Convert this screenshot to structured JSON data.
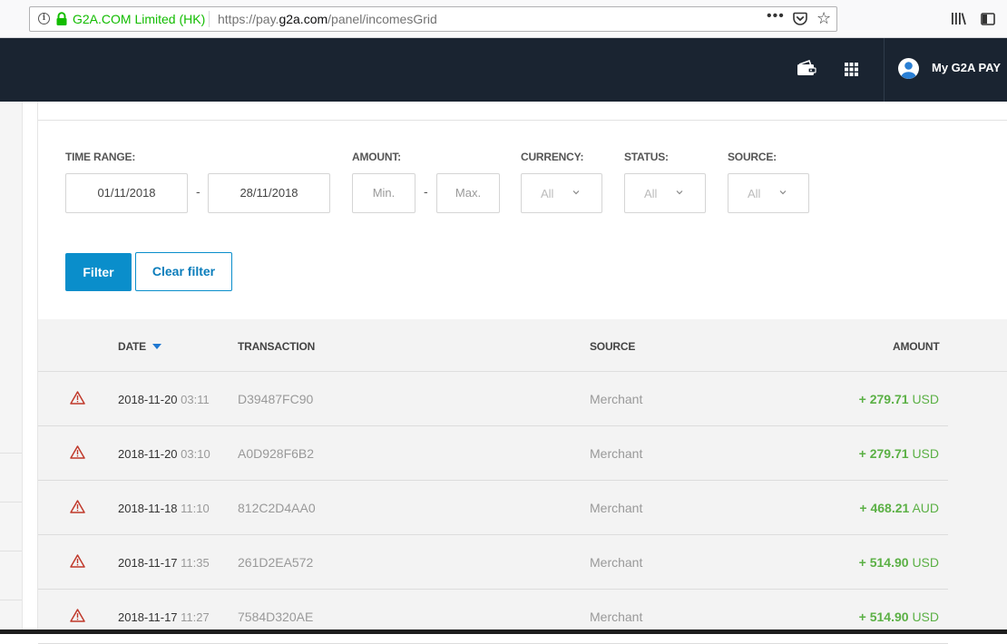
{
  "browser": {
    "site_identity": "G2A.COM Limited (HK)",
    "url_prefix": "https://pay.",
    "url_domain": "g2a.com",
    "url_path": "/panel/incomesGrid",
    "page_actions": "•••"
  },
  "header": {
    "account_label": "My G2A PAY",
    "brand_color": "#1a2431"
  },
  "filters": {
    "time_range_label": "TIME RANGE:",
    "date_from": "01/11/2018",
    "date_to": "28/11/2018",
    "amount_label": "AMOUNT:",
    "amount_min_placeholder": "Min.",
    "amount_max_placeholder": "Max.",
    "currency_label": "CURRENCY:",
    "currency_value": "All",
    "status_label": "STATUS:",
    "status_value": "All",
    "source_label": "SOURCE:",
    "source_value": "All",
    "range_separator": "-",
    "filter_button": "Filter",
    "clear_button": "Clear filter",
    "accent_color": "#0a8ecb"
  },
  "table": {
    "columns": {
      "date": "DATE",
      "transaction": "TRANSACTION",
      "source": "SOURCE",
      "amount": "AMOUNT"
    },
    "sort": {
      "column": "date",
      "direction": "descending"
    },
    "rows": [
      {
        "date": "2018-11-20",
        "time": "03:11",
        "transaction": "D39487FC90",
        "source": "Merchant",
        "amount": "+ 279.71",
        "currency": "USD",
        "status_icon": "warning-icon"
      },
      {
        "date": "2018-11-20",
        "time": "03:10",
        "transaction": "A0D928F6B2",
        "source": "Merchant",
        "amount": "+ 279.71",
        "currency": "USD",
        "status_icon": "warning-icon"
      },
      {
        "date": "2018-11-18",
        "time": "11:10",
        "transaction": "812C2D4AA0",
        "source": "Merchant",
        "amount": "+ 468.21",
        "currency": "AUD",
        "status_icon": "warning-icon"
      },
      {
        "date": "2018-11-17",
        "time": "11:35",
        "transaction": "261D2EA572",
        "source": "Merchant",
        "amount": "+ 514.90",
        "currency": "USD",
        "status_icon": "warning-icon"
      },
      {
        "date": "2018-11-17",
        "time": "11:27",
        "transaction": "7584D320AE",
        "source": "Merchant",
        "amount": "+ 514.90",
        "currency": "USD",
        "status_icon": "warning-icon"
      }
    ],
    "positive_color": "#5bb045",
    "warning_color": "#c0392b"
  }
}
